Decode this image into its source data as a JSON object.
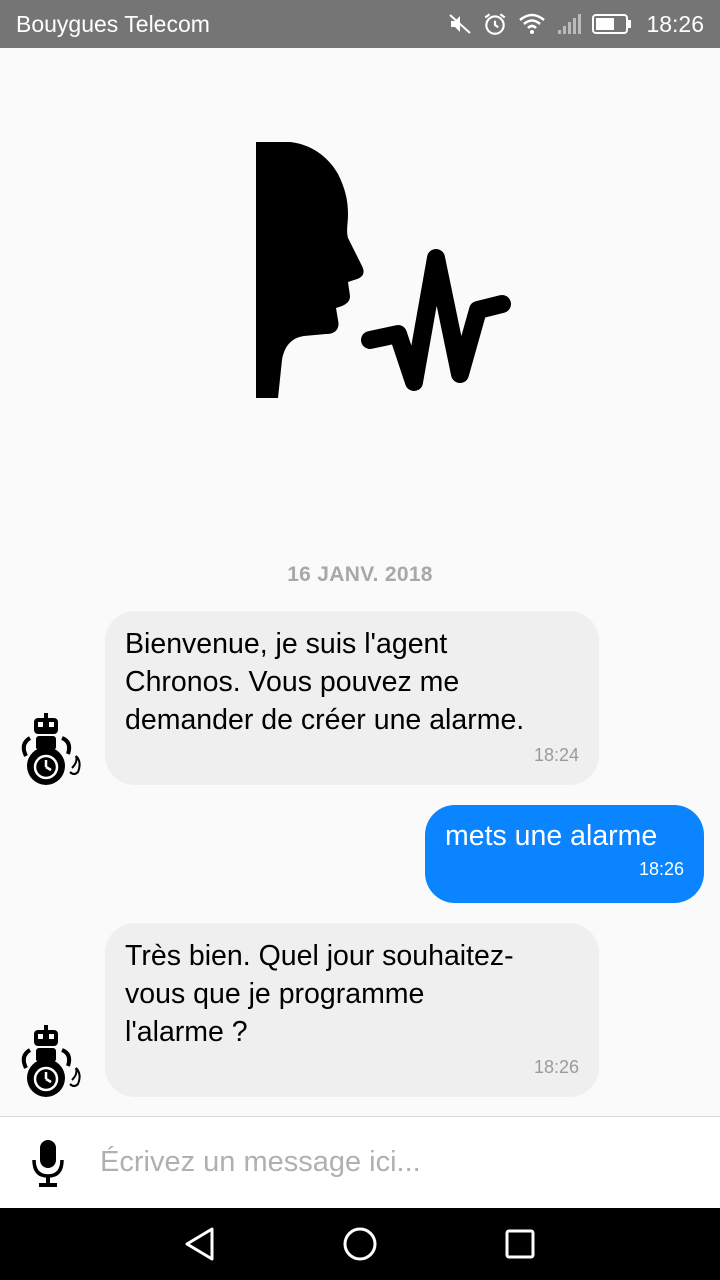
{
  "status_bar": {
    "carrier": "Bouygues Telecom",
    "time": "18:26",
    "icons": [
      "mute-icon",
      "alarm-icon",
      "wifi-icon",
      "signal-icon",
      "battery-icon"
    ]
  },
  "chat": {
    "date_separator": "16 JANV. 2018",
    "messages": [
      {
        "sender": "bot",
        "text": "Bienvenue, je suis l'agent\nChronos. Vous pouvez me\ndemander de créer une alarme.",
        "time": "18:24"
      },
      {
        "sender": "user",
        "text": "mets une alarme",
        "time": "18:26"
      },
      {
        "sender": "bot",
        "text": "Très bien. Quel jour souhaitez-\nvous que je programme\nl'alarme ?",
        "time": "18:26"
      }
    ]
  },
  "input": {
    "placeholder": "Écrivez un message ici..."
  },
  "colors": {
    "user_bubble": "#0a84ff",
    "bot_bubble": "#efefef",
    "status_bar": "#757575"
  }
}
